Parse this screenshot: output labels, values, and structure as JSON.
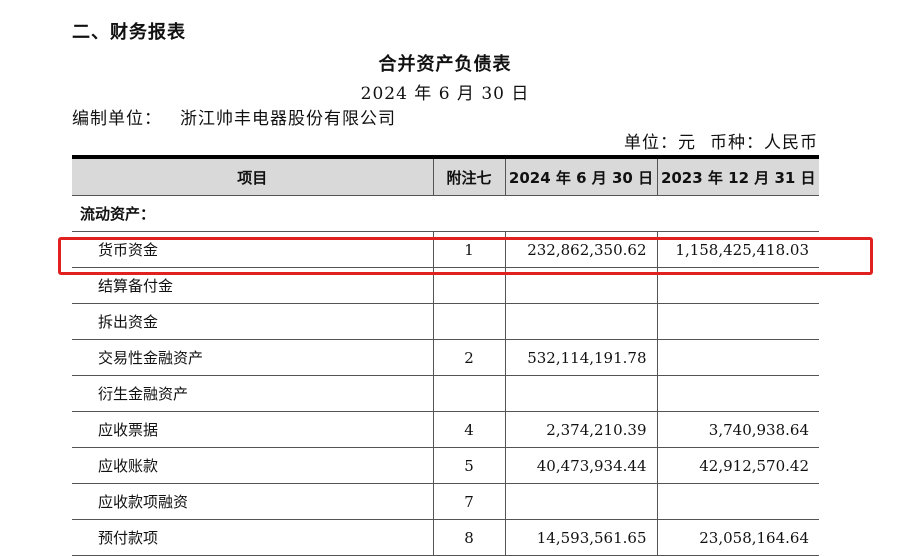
{
  "section_heading": "二、财务报表",
  "statement": {
    "title": "合并资产负债表",
    "date": "2024 年 6 月 30 日",
    "company_label": "编制单位：",
    "company_name": "浙江帅丰电器股份有限公司",
    "unit_label": "单位：元",
    "currency_label": "币种：人民币"
  },
  "table": {
    "headers": {
      "item": "项目",
      "note": "附注七",
      "current": "2024 年 6 月 30 日",
      "prior": "2023 年 12 月 31 日"
    },
    "section": "流动资产：",
    "rows": [
      {
        "item": "货币资金",
        "note": "1",
        "current": "232,862,350.62",
        "prior": "1,158,425,418.03"
      },
      {
        "item": "结算备付金",
        "note": "",
        "current": "",
        "prior": ""
      },
      {
        "item": "拆出资金",
        "note": "",
        "current": "",
        "prior": ""
      },
      {
        "item": "交易性金融资产",
        "note": "2",
        "current": "532,114,191.78",
        "prior": ""
      },
      {
        "item": "衍生金融资产",
        "note": "",
        "current": "",
        "prior": ""
      },
      {
        "item": "应收票据",
        "note": "4",
        "current": "2,374,210.39",
        "prior": "3,740,938.64"
      },
      {
        "item": "应收账款",
        "note": "5",
        "current": "40,473,934.44",
        "prior": "42,912,570.42"
      },
      {
        "item": "应收款项融资",
        "note": "7",
        "current": "",
        "prior": ""
      },
      {
        "item": "预付款项",
        "note": "8",
        "current": "14,593,561.65",
        "prior": "23,058,164.64"
      }
    ]
  },
  "colors": {
    "highlight": "#e0211f",
    "header_bg": "#d9d9d9"
  }
}
